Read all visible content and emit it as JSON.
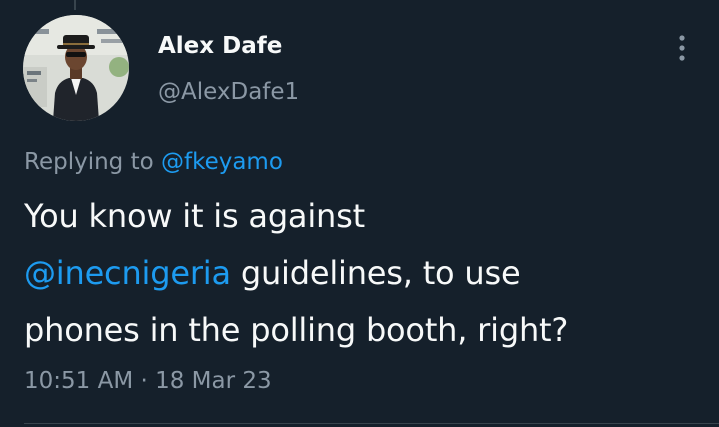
{
  "user": {
    "display_name": "Alex Dafe",
    "handle": "@AlexDafe1"
  },
  "reply": {
    "prefix": "Replying to",
    "mention": "@fkeyamo"
  },
  "tweet": {
    "line1": "You know it is against",
    "mention": "@inecnigeria",
    "line2_rest": " guidelines, to use",
    "line3": "phones in the polling booth, right?"
  },
  "meta": {
    "time": "10:51 AM",
    "separator": "·",
    "date": "18 Mar 23"
  },
  "icons": {
    "avatar": "profile-photo",
    "more": "more-vertical-icon"
  },
  "colors": {
    "background": "#15202b",
    "text": "#f7f9f9",
    "secondary": "#8b98a5",
    "accent": "#1d9bf0"
  }
}
